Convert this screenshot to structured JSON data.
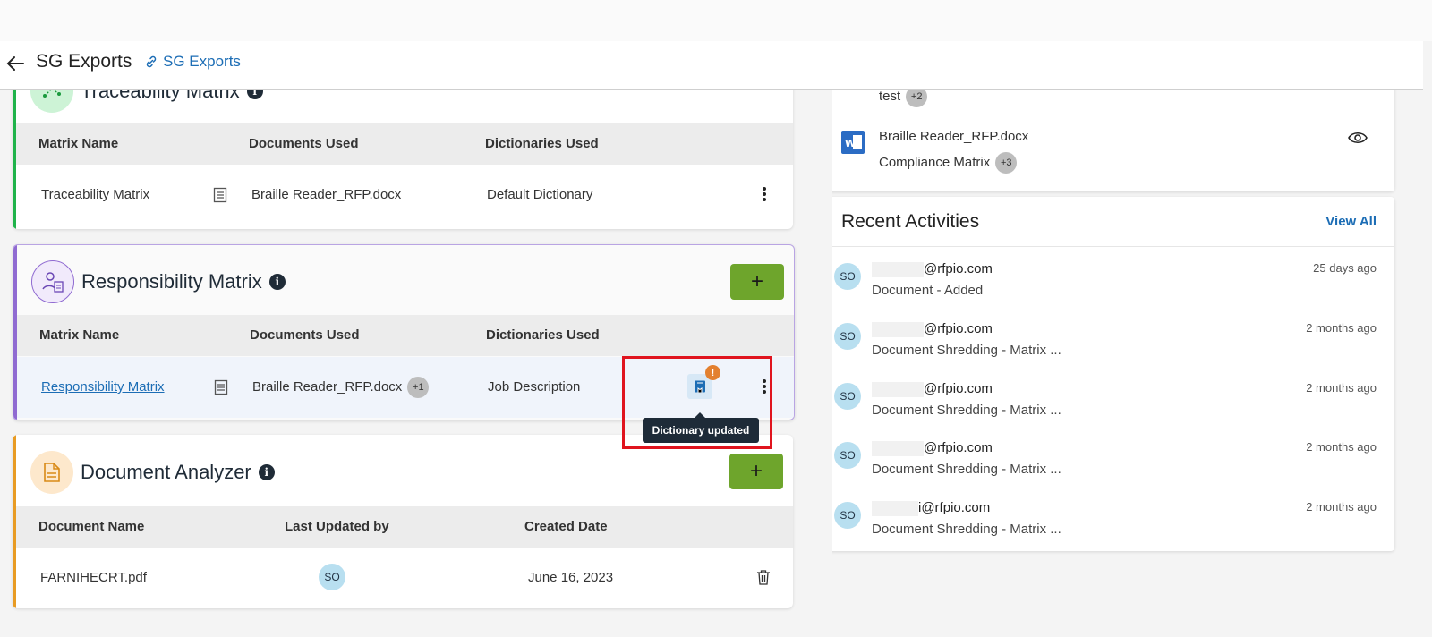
{
  "header": {
    "title": "SG Exports",
    "link_label": "SG Exports"
  },
  "traceability": {
    "title": "Traceability Matrix",
    "columns": [
      "Matrix Name",
      "Documents Used",
      "Dictionaries Used"
    ],
    "row": {
      "name": "Traceability Matrix",
      "document": "Braille Reader_RFP.docx",
      "dictionary": "Default Dictionary"
    }
  },
  "responsibility": {
    "title": "Responsibility Matrix",
    "add_label": "+",
    "columns": [
      "Matrix Name",
      "Documents Used",
      "Dictionaries Used"
    ],
    "row": {
      "name": "Responsibility Matrix",
      "document": "Braille Reader_RFP.docx",
      "doc_badge": "+1",
      "dictionary": "Job Description"
    },
    "alert_glyph": "!",
    "tooltip": "Dictionary updated"
  },
  "analyzer": {
    "title": "Document Analyzer",
    "add_label": "+",
    "columns": [
      "Document Name",
      "Last Updated by",
      "Created Date"
    ],
    "row": {
      "name": "FARNIHECRT.pdf",
      "avatar": "SO",
      "date": "June 16, 2023"
    }
  },
  "documents_panel": {
    "top_text": "test",
    "top_badge": "+2",
    "file_name": "Braille Reader_RFP.docx",
    "file_sub": "Compliance Matrix",
    "file_badge": "+3"
  },
  "activities": {
    "title": "Recent Activities",
    "view_all": "View All",
    "items": [
      {
        "avatar": "SO",
        "email": "@rfpio.com",
        "desc": "Document - Added",
        "time": "25 days ago"
      },
      {
        "avatar": "SO",
        "email": "@rfpio.com",
        "desc": "Document Shredding - Matrix ...",
        "time": "2 months ago"
      },
      {
        "avatar": "SO",
        "email": "@rfpio.com",
        "desc": "Document Shredding - Matrix ...",
        "time": "2 months ago"
      },
      {
        "avatar": "SO",
        "email": "@rfpio.com",
        "desc": "Document Shredding - Matrix ...",
        "time": "2 months ago"
      },
      {
        "avatar": "SO",
        "email": "i@rfpio.com",
        "desc": "Document Shredding - Matrix ...",
        "time": "2 months ago"
      }
    ]
  },
  "colors": {
    "traceability_accent": "#1fb34a",
    "responsibility_accent": "#8f6ad1",
    "analyzer_accent": "#e89b23",
    "add_button": "#6ea52c",
    "link": "#1c6db5"
  }
}
